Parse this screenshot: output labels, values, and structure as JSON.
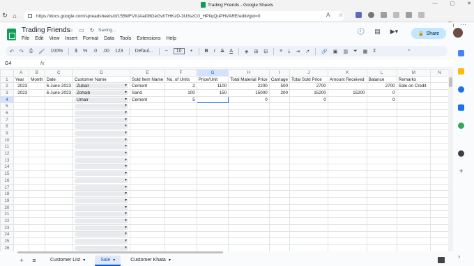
{
  "window": {
    "title": "Trading Friends - Google Sheets",
    "controls": [
      "—",
      "▢",
      "✕"
    ]
  },
  "browser": {
    "url": "https://docs.google.com/spreadsheets/d/155MFVIUAai08GeGvhTHKzD-3U3szC0_HPIiqQuPHVARE/edit#gid=0"
  },
  "doc": {
    "title": "Trading Friends",
    "status": "Saving...",
    "menu": [
      "File",
      "Edit",
      "View",
      "Insert",
      "Format",
      "Data",
      "Tools",
      "Extensions",
      "Help"
    ],
    "share_label": "Share"
  },
  "toolbar": {
    "zoom": "100%",
    "currency": "$",
    "percent": "%",
    "dec_less": ".0",
    "dec_more": ".00",
    "number_format": "123",
    "font": "Defaul...",
    "font_size": "10",
    "minus": "−",
    "plus": "+",
    "bold": "B",
    "italic": "I",
    "strike": "S",
    "textcolor": "A"
  },
  "formula": {
    "cell_ref": "G4",
    "fx": "fx",
    "value": ""
  },
  "grid": {
    "columns": [
      "A",
      "B",
      "C",
      "D",
      "E",
      "F",
      "G",
      "H",
      "I",
      "J",
      "K",
      "L",
      "M",
      "N"
    ],
    "selected_column": "G",
    "selected_row": "4",
    "headers": [
      "Year",
      "Month",
      "Date",
      "Customer Name",
      "Sold Item Name",
      "No. of Units",
      "Price/Unit",
      "Total Material Price",
      "Carriage",
      "Total Sold Price",
      "Amount Received",
      "Balance",
      "Remarks",
      ""
    ],
    "data_rows": [
      [
        "2023",
        "",
        "6-June-2023",
        "Zubair",
        "Cement",
        "2",
        "1100",
        "2200",
        "500",
        "2700",
        "",
        "2700",
        "Sale on Credit",
        ""
      ],
      [
        "2023",
        "",
        "6-June-2023",
        "Zohaib",
        "Sand",
        "100",
        "150",
        "15000",
        "200",
        "15200",
        "15200",
        "0",
        "",
        ""
      ],
      [
        "",
        "",
        "",
        "Umair",
        "Cement",
        "5",
        "",
        "0",
        "",
        "0",
        "",
        "0",
        "",
        ""
      ]
    ],
    "row_numbers": [
      "1",
      "2",
      "3",
      "4",
      "5",
      "6",
      "7",
      "8",
      "9",
      "10",
      "11",
      "12",
      "13",
      "14",
      "15",
      "16",
      "17",
      "18",
      "19",
      "20",
      "21",
      "22",
      "23",
      "24",
      "25",
      "26"
    ]
  },
  "sheets": {
    "tabs": [
      {
        "label": "Customer List",
        "active": false
      },
      {
        "label": "Sale",
        "active": true
      },
      {
        "label": "Customer Khata",
        "active": false
      }
    ]
  },
  "colors": {
    "accent": "#0b57d0",
    "sheets_green": "#0f9d58",
    "share_bg": "#c2e7ff"
  }
}
